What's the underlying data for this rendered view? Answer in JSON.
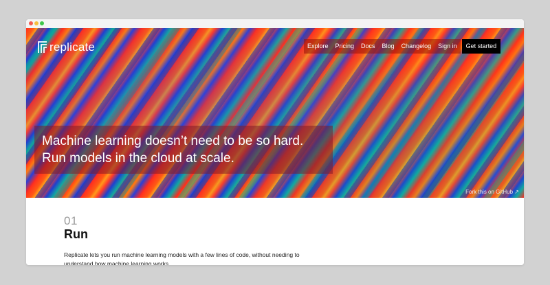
{
  "window": {
    "controls": [
      "close",
      "minimize",
      "maximize"
    ]
  },
  "header": {
    "logo_text": "replicate",
    "nav": [
      {
        "label": "Explore"
      },
      {
        "label": "Pricing"
      },
      {
        "label": "Docs"
      },
      {
        "label": "Blog"
      },
      {
        "label": "Changelog"
      },
      {
        "label": "Sign in"
      }
    ],
    "cta_label": "Get started"
  },
  "hero": {
    "line1": "Machine learning doesn’t need to be so hard.",
    "line2": "Run models in the cloud at scale.",
    "fork_link": "Fork this on GitHub ↗"
  },
  "section": {
    "number": "01",
    "title": "Run",
    "body": "Replicate lets you run machine learning models with a few lines of code, without needing to understand how machine learning works."
  },
  "colors": {
    "page_background": "#d2d2d2",
    "nav_cta": "#000000",
    "hero_red": "#ff2f1f",
    "hero_blue": "#1f3fd0",
    "hero_teal": "#12a8a0"
  }
}
